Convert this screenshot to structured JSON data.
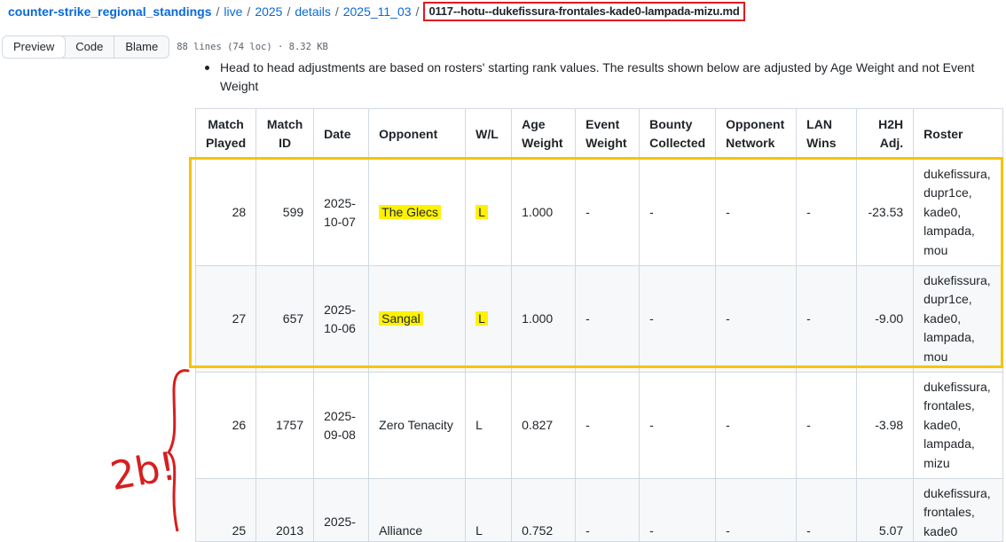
{
  "breadcrumb": {
    "repo": "counter-strike_regional_standings",
    "parts": [
      "live",
      "2025",
      "details",
      "2025_11_03"
    ],
    "file": "0117--hotu--dukefissura-frontales-kade0-lampada-mizu.md"
  },
  "toolbar": {
    "preview": "Preview",
    "code": "Code",
    "blame": "Blame",
    "meta": "88 lines (74 loc) · 8.32 KB"
  },
  "bullet_text": "Head to head adjustments are based on rosters' starting rank values. The results shown below are adjusted by Age Weight and not Event Weight",
  "table": {
    "headers": [
      "Match Played",
      "Match ID",
      "Date",
      "Opponent",
      "W/L",
      "Age Weight",
      "Event Weight",
      "Bounty Collected",
      "Opponent Network",
      "LAN Wins",
      "H2H Adj.",
      "Roster"
    ],
    "header_lines": [
      [
        "Match",
        "Played"
      ],
      [
        "Match",
        "ID"
      ],
      [
        "Date"
      ],
      [
        "Opponent"
      ],
      [
        "W/L"
      ],
      [
        "Age",
        "Weight"
      ],
      [
        "Event",
        "Weight"
      ],
      [
        "Bounty",
        "Collected"
      ],
      [
        "Opponent",
        "Network"
      ],
      [
        "LAN",
        "Wins"
      ],
      [
        "H2H",
        "Adj."
      ],
      [
        "Roster"
      ]
    ],
    "rows": [
      {
        "played": "28",
        "id": "599",
        "date": [
          "2025-",
          "10-07"
        ],
        "opponent": "The Glecs",
        "wl": "L",
        "age": "1.000",
        "event": "-",
        "bounty": "-",
        "network": "-",
        "lan": "-",
        "h2h": "-23.53",
        "roster": [
          "dukefissura,",
          "dupr1ce,",
          "kade0,",
          "lampada,",
          "mou"
        ]
      },
      {
        "played": "27",
        "id": "657",
        "date": [
          "2025-",
          "10-06"
        ],
        "opponent": "Sangal",
        "wl": "L",
        "age": "1.000",
        "event": "-",
        "bounty": "-",
        "network": "-",
        "lan": "-",
        "h2h": "-9.00",
        "roster": [
          "dukefissura,",
          "dupr1ce,",
          "kade0,",
          "lampada,",
          "mou"
        ]
      },
      {
        "played": "26",
        "id": "1757",
        "date": [
          "2025-",
          "09-08"
        ],
        "opponent": "Zero Tenacity",
        "wl": "L",
        "age": "0.827",
        "event": "-",
        "bounty": "-",
        "network": "-",
        "lan": "-",
        "h2h": "-3.98",
        "roster": [
          "dukefissura,",
          "frontales,",
          "kade0,",
          "lampada,",
          "mizu"
        ]
      },
      {
        "played": "25",
        "id": "2013",
        "date": [
          "2025-"
        ],
        "opponent": "Alliance",
        "wl": "L",
        "age": "0.752",
        "event": "-",
        "bounty": "-",
        "network": "-",
        "lan": "-",
        "h2h": "5.07",
        "roster": [
          "dukefissura,",
          "frontales,",
          "kade0"
        ]
      }
    ]
  },
  "annotation_text": "2b!",
  "colors": {
    "highlight": "#fff200",
    "box_yellow": "#f5c400",
    "box_red": "#e0191f",
    "pen_red": "#d81e1e",
    "link": "#0969da"
  }
}
